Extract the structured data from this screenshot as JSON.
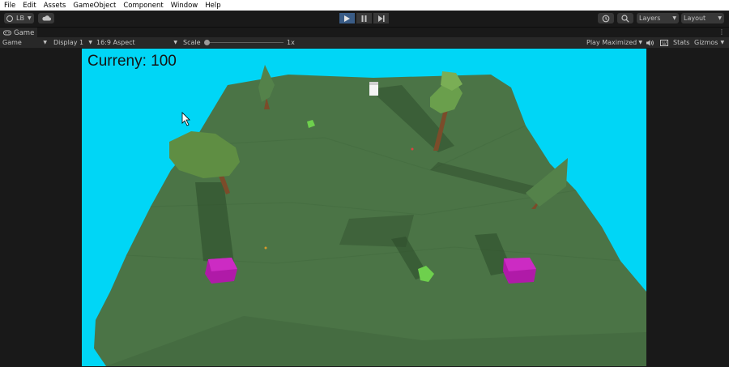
{
  "menubar": {
    "items": [
      "File",
      "Edit",
      "Assets",
      "GameObject",
      "Component",
      "Window",
      "Help"
    ]
  },
  "toolbar": {
    "account_label": "LB",
    "layers_label": "Layers",
    "layout_label": "Layout"
  },
  "tab": {
    "label": "Game"
  },
  "game_controls": {
    "view_label": "Game",
    "display_label": "Display 1",
    "aspect_label": "16:9 Aspect",
    "scale_label": "Scale",
    "scale_value": "1x",
    "play_mode_label": "Play Maximized",
    "stats_label": "Stats",
    "gizmos_label": "Gizmos"
  },
  "game": {
    "currency_text": "Curreny: 100"
  },
  "colors": {
    "sky": "#00d6f6",
    "terrain": "#4b7446",
    "pad": "#b01aa8",
    "play_active": "#3a5c86"
  }
}
